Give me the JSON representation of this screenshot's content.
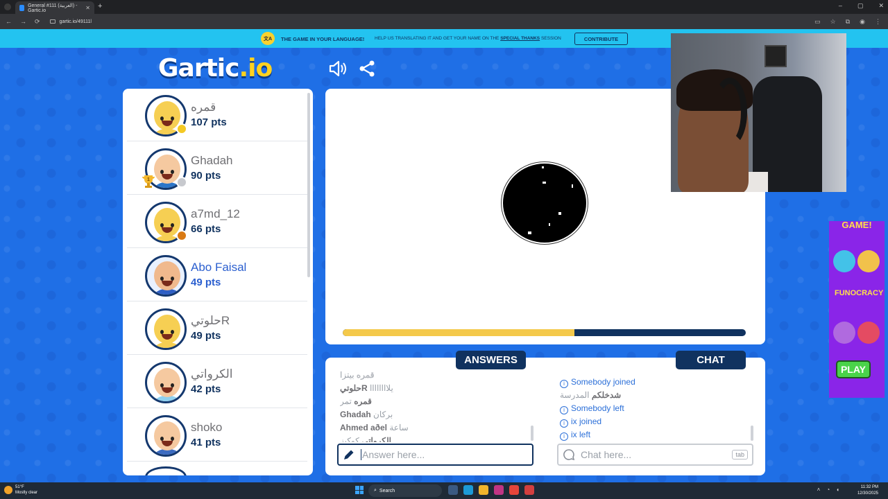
{
  "browser": {
    "tab_title": "General #111 (العربية) - Gartic.io",
    "tab_close": "✕",
    "new_tab": "+",
    "url": "gartic.io/49111l",
    "window_controls": [
      "–",
      "▢",
      "✕"
    ]
  },
  "banner": {
    "badge": "文A",
    "headline": "THE GAME IN YOUR LANGUAGE!",
    "text_before": "HELP US TRANSLATING IT AND GET YOUR NAME ON THE ",
    "text_link": "SPECIAL THANKS",
    "text_after": " SESSION",
    "contribute": "CONTRIBUTE"
  },
  "logo": {
    "main": "Gartic",
    "suffix": ".io"
  },
  "players": [
    {
      "name": "قمره",
      "pts": "107 pts",
      "skin": "#f6cf53",
      "body": "#f6cf53",
      "dot": "#f4c924",
      "active": false,
      "trophy": false
    },
    {
      "name": "Ghadah",
      "pts": "90 pts",
      "skin": "#f5c9a0",
      "body": "#2d76c9",
      "dot": "#c7c9ce",
      "active": false,
      "trophy": true,
      "trophy_rank": "1"
    },
    {
      "name": "a7md_12",
      "pts": "66 pts",
      "skin": "#f6cf53",
      "body": "#f6cf53",
      "dot": "#d97a14",
      "active": false,
      "trophy": false
    },
    {
      "name": "Abo Faisal",
      "pts": "49 pts",
      "skin": "#f0b98d",
      "body": "#2f5fc4",
      "dot": "",
      "active": true,
      "trophy": false
    },
    {
      "name": "حلوتيR",
      "pts": "49 pts",
      "skin": "#f6cf53",
      "body": "#f6cf53",
      "dot": "",
      "active": false,
      "trophy": false
    },
    {
      "name": "الكرواتي",
      "pts": "42 pts",
      "skin": "#f5c9a0",
      "body": "#8fd0ef",
      "dot": "",
      "active": false,
      "trophy": false
    },
    {
      "name": "shoko",
      "pts": "41 pts",
      "skin": "#f5c9a0",
      "body": "#3c6bc0",
      "dot": "",
      "active": false,
      "trophy": false
    }
  ],
  "timer": {
    "progress": 0.575
  },
  "answers_tab": "ANSWERS",
  "chat_tab": "CHAT",
  "answers": [
    {
      "user": "قمره",
      "text": "بيتزا",
      "faded": true
    },
    {
      "user": "حلوتيR",
      "text": "يلاااااااا",
      "faded": false
    },
    {
      "user": "قمره",
      "text": "تمر",
      "faded": false
    },
    {
      "user": "Ghadah",
      "text": "بركان",
      "faded": false
    },
    {
      "user": "Ahmed aðel",
      "text": "ساعة",
      "faded": false
    },
    {
      "user": "الكرواتي",
      "text": "كوكيز",
      "faded": false
    }
  ],
  "chat": [
    {
      "type": "event",
      "who": "Somebody",
      "action": "joined"
    },
    {
      "type": "msg",
      "user": "شدخلكم",
      "text": "المدرسة"
    },
    {
      "type": "event",
      "who": "Somebody",
      "action": "left"
    },
    {
      "type": "event",
      "who": "ix",
      "action": "joined"
    },
    {
      "type": "event",
      "who": "ix",
      "action": "left"
    }
  ],
  "answer_input": {
    "placeholder": "Answer here..."
  },
  "chat_input": {
    "placeholder": "Chat here...",
    "key_hint": "tab"
  },
  "ad": {
    "top_text": "GAME!",
    "brand": "FUNOCRACY",
    "play": "PLAY"
  },
  "taskbar": {
    "weather_temp": "51°F",
    "weather_desc": "Mostly clear",
    "search": "Search",
    "time": "11:32 PM",
    "date": "12/30/2025"
  }
}
